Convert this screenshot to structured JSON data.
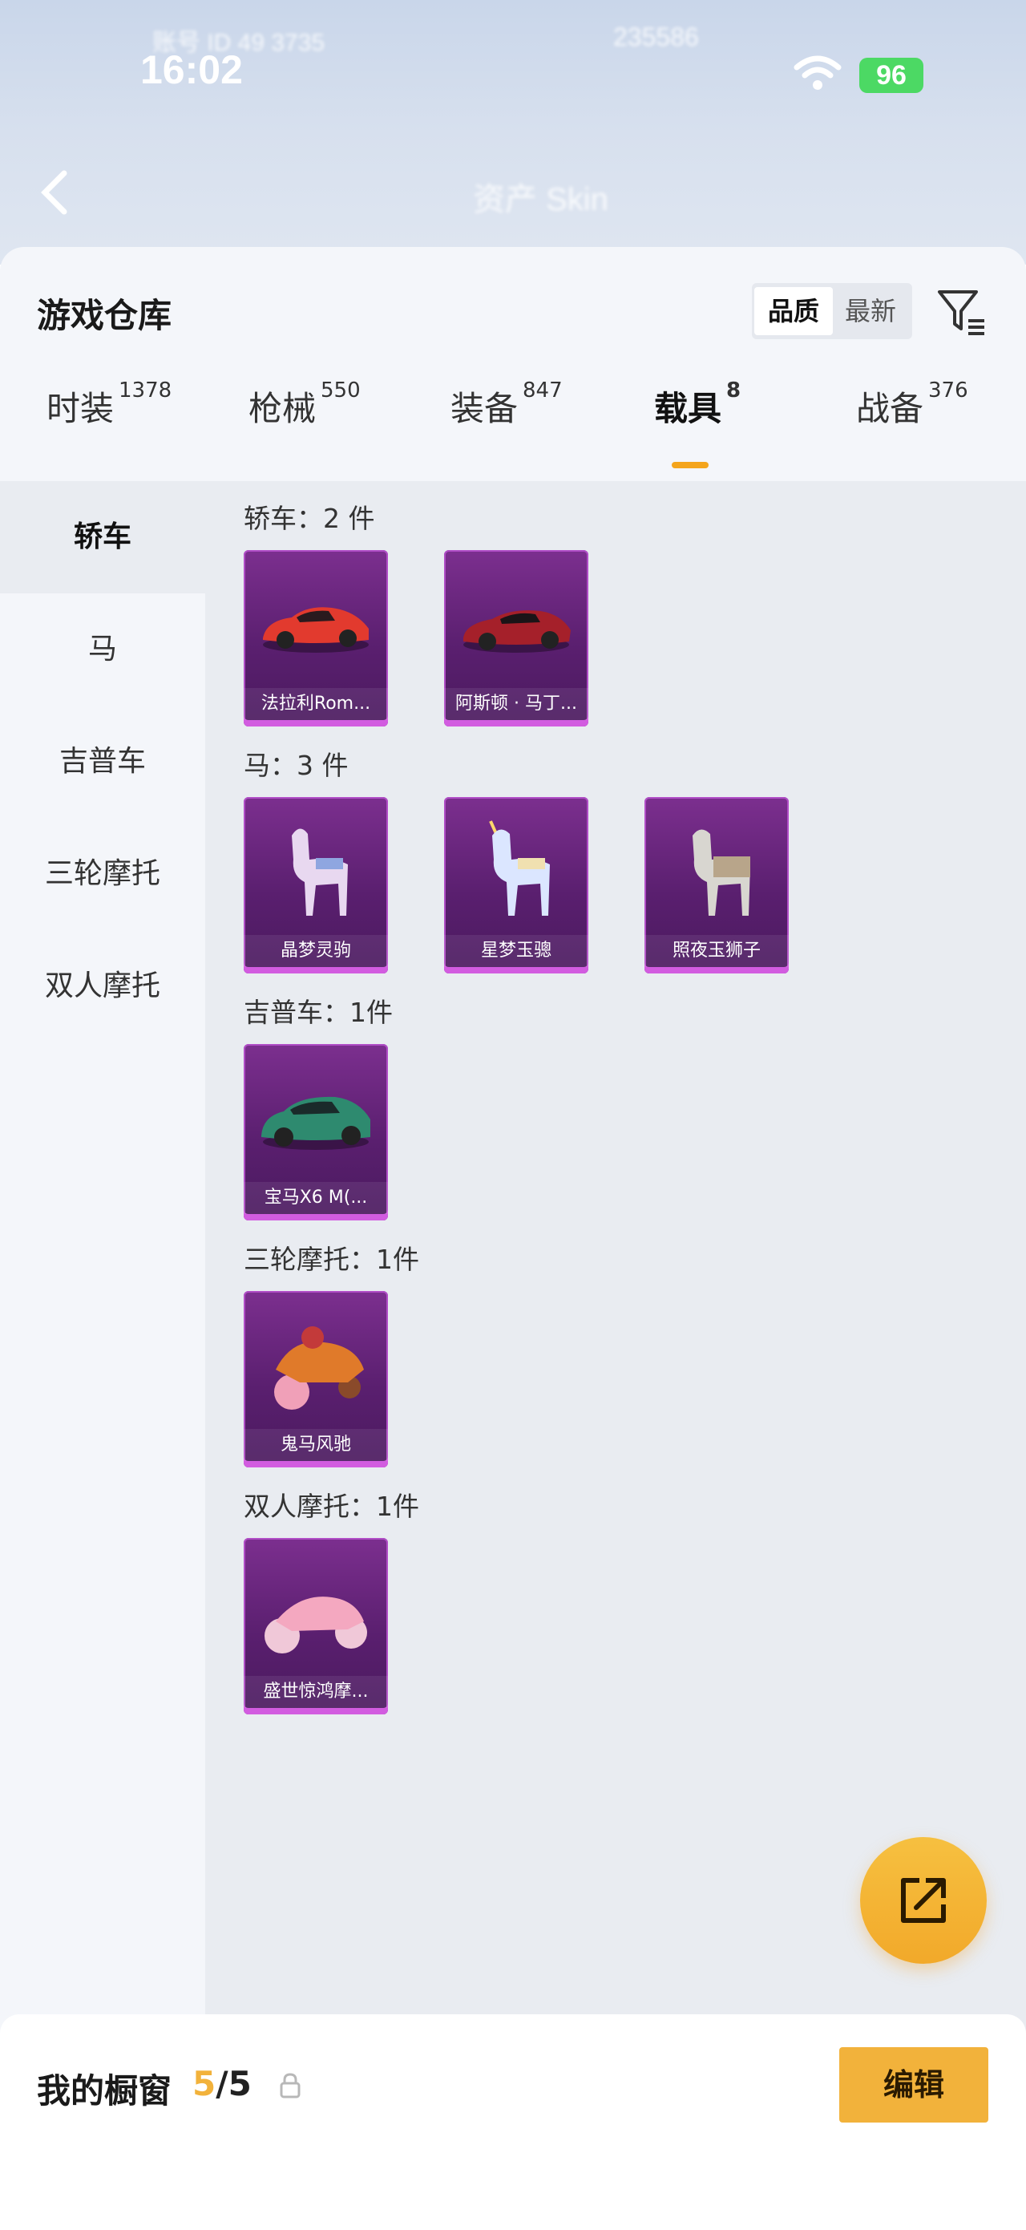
{
  "status_bar": {
    "time": "16:02",
    "battery": "96"
  },
  "background_header": {
    "blurred_left": "账号 ID 49 3735",
    "blurred_right": "235586",
    "blurred_tab": "资产 Skin"
  },
  "sheet": {
    "title": "游戏仓库",
    "sort": {
      "active": "品质",
      "inactive": "最新"
    }
  },
  "tabs": [
    {
      "label": "时装",
      "count": "1378"
    },
    {
      "label": "枪械",
      "count": "550"
    },
    {
      "label": "装备",
      "count": "847"
    },
    {
      "label": "载具",
      "count": "8"
    },
    {
      "label": "战备",
      "count": "376"
    }
  ],
  "sidebar": {
    "items": [
      {
        "label": "轿车"
      },
      {
        "label": "马"
      },
      {
        "label": "吉普车"
      },
      {
        "label": "三轮摩托"
      },
      {
        "label": "双人摩托"
      }
    ]
  },
  "sections": [
    {
      "label": "轿车：2 件",
      "items": [
        "法拉利Rom...",
        "阿斯顿 · 马丁..."
      ]
    },
    {
      "label": "马：3 件",
      "items": [
        "晶梦灵驹",
        "星梦玉骢",
        "照夜玉狮子"
      ]
    },
    {
      "label": "吉普车：1件",
      "items": [
        "宝马X6 M(..."
      ]
    },
    {
      "label": "三轮摩托：1件",
      "items": [
        "鬼马风驰"
      ]
    },
    {
      "label": "双人摩托：1件",
      "items": [
        "盛世惊鸿摩..."
      ]
    }
  ],
  "showcase": {
    "label": "我的橱窗",
    "current": "5",
    "slash": "/",
    "total": "5",
    "edit_label": "编辑"
  },
  "colors": {
    "accent": "#f2b23b",
    "card_purple": "#5a1f6f",
    "card_edge": "#d25ce0"
  }
}
